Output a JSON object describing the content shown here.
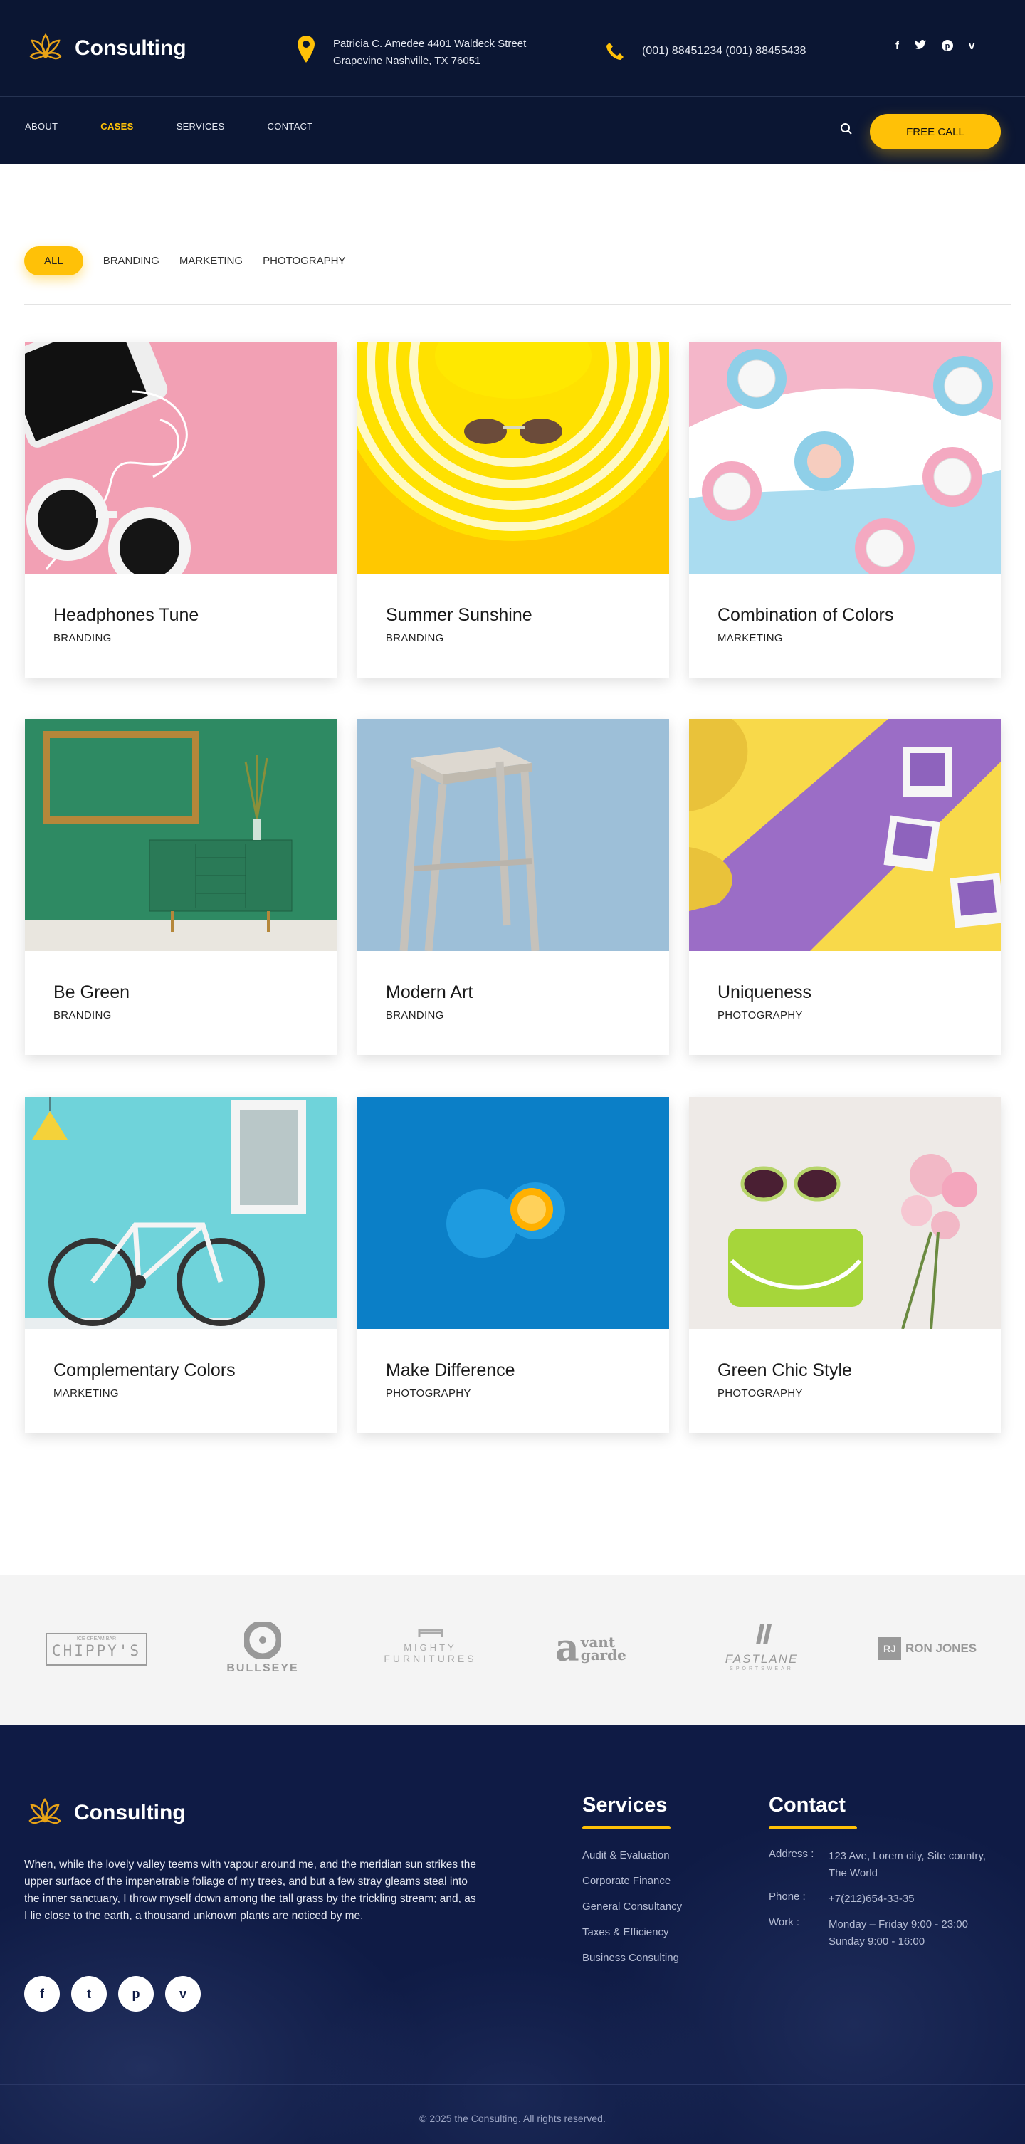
{
  "brand": {
    "name": "Consulting",
    "accent": "#ffc107",
    "navy": "#0b1633"
  },
  "header": {
    "address_line1": "Patricia C. Amedee 4401 Waldeck Street",
    "address_line2": "Grapevine Nashville, TX 76051",
    "phones": "(001) 88451234  (001) 88455438",
    "social_icons": [
      "facebook-icon",
      "twitter-icon",
      "pinterest-icon",
      "vimeo-icon"
    ],
    "nav": [
      {
        "label": "ABOUT"
      },
      {
        "label": "CASES",
        "active": true
      },
      {
        "label": "SERVICES"
      },
      {
        "label": "CONTACT"
      }
    ],
    "cta": "FREE CALL"
  },
  "filters": [
    {
      "label": "ALL",
      "active": true
    },
    {
      "label": "BRANDING"
    },
    {
      "label": "MARKETING"
    },
    {
      "label": "PHOTOGRAPHY"
    }
  ],
  "cases": [
    {
      "title": "Headphones Tune",
      "category": "BRANDING"
    },
    {
      "title": "Summer Sunshine",
      "category": "BRANDING"
    },
    {
      "title": "Combination of Colors",
      "category": "MARKETING"
    },
    {
      "title": "Be Green",
      "category": "BRANDING"
    },
    {
      "title": "Modern Art",
      "category": "BRANDING"
    },
    {
      "title": "Uniqueness",
      "category": "PHOTOGRAPHY"
    },
    {
      "title": "Complementary Colors",
      "category": "MARKETING"
    },
    {
      "title": "Make Difference",
      "category": "PHOTOGRAPHY"
    },
    {
      "title": "Green Chic Style",
      "category": "PHOTOGRAPHY"
    }
  ],
  "clients": {
    "chippys": {
      "small": "ICE CREAM BAR",
      "name": "CHIPPY'S"
    },
    "bullseye": "BULLSEYE",
    "mighty": {
      "line1": "MIGHTY",
      "line2": "FURNITURES"
    },
    "vant": {
      "letter": "a",
      "word1": "vant",
      "word2": "garde"
    },
    "fastlane": {
      "name": "FASTLANE",
      "small": "SPORTSWEAR"
    },
    "ronjones": {
      "badge": "RJ",
      "name": "RON JONES"
    }
  },
  "footer": {
    "description": "When, while the lovely valley teems with vapour around me, and the meridian sun strikes the upper surface of the impenetrable foliage of my trees, and but a few stray gleams steal into the inner sanctuary, I throw myself down among the tall grass by the trickling stream; and, as I lie close to the earth, a thousand unknown plants are noticed by me.",
    "services_title": "Services",
    "services": [
      "Audit & Evaluation",
      "Corporate Finance",
      "General Consultancy",
      "Taxes & Efficiency",
      "Business Consulting"
    ],
    "contact_title": "Contact",
    "contact": [
      {
        "label": "Address :",
        "value": "123 Ave, Lorem city, Site country, The World"
      },
      {
        "label": "Phone :",
        "value": "+7(212)654-33-35"
      },
      {
        "label": "Work :",
        "value": "Monday – Friday 9:00 - 23:00 Sunday 9:00 - 16:00"
      }
    ],
    "social_glyphs": [
      "f",
      "t",
      "p",
      "v"
    ],
    "copyright": "© 2025 the Consulting. All rights reserved."
  }
}
